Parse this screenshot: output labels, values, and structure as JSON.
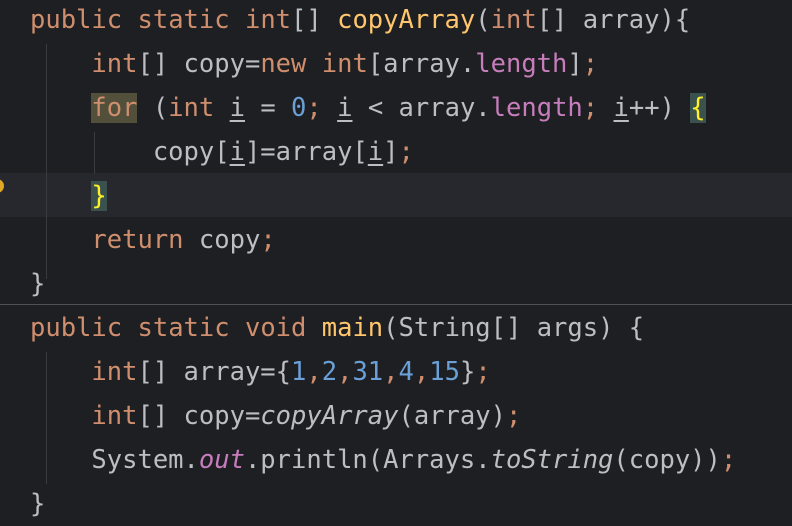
{
  "lines": [
    {
      "segments": [
        [
          "kw",
          "public"
        ],
        [
          " ",
          " "
        ],
        [
          "kw",
          "static"
        ],
        [
          " ",
          " "
        ],
        [
          "kw",
          "int"
        ],
        [
          "plain",
          "[] "
        ],
        [
          "def",
          "copyArray"
        ],
        [
          "plain",
          "("
        ],
        [
          "kw",
          "int"
        ],
        [
          "plain",
          "[] array){"
        ]
      ]
    },
    {
      "segments": [
        [
          "plain",
          "    "
        ],
        [
          "kw",
          "int"
        ],
        [
          "plain",
          "[] copy="
        ],
        [
          "kw",
          "new"
        ],
        [
          "plain",
          " "
        ],
        [
          "kw",
          "int"
        ],
        [
          "plain",
          "[array."
        ],
        [
          "fld",
          "length"
        ],
        [
          "plain",
          "]"
        ],
        [
          "semi",
          ";"
        ]
      ]
    },
    {
      "segments": [
        [
          "plain",
          "    "
        ],
        [
          "kw-hl",
          "for"
        ],
        [
          "plain",
          " ("
        ],
        [
          "kw",
          "int"
        ],
        [
          "plain",
          " "
        ],
        [
          "var-u",
          "i"
        ],
        [
          "plain",
          " = "
        ],
        [
          "num",
          "0"
        ],
        [
          "semi",
          ";"
        ],
        [
          "plain",
          " "
        ],
        [
          "var-u",
          "i"
        ],
        [
          "plain",
          " < array."
        ],
        [
          "fld",
          "length"
        ],
        [
          "semi",
          ";"
        ],
        [
          "plain",
          " "
        ],
        [
          "var-u",
          "i"
        ],
        [
          "plain",
          "++) "
        ],
        [
          "brace-hl",
          "{"
        ]
      ]
    },
    {
      "segments": [
        [
          "plain",
          "        copy["
        ],
        [
          "var-u",
          "i"
        ],
        [
          "plain",
          "]=array["
        ],
        [
          "var-u",
          "i"
        ],
        [
          "plain",
          "]"
        ],
        [
          "semi",
          ";"
        ]
      ]
    },
    {
      "segments": [
        [
          "plain",
          "    "
        ],
        [
          "brace-hl",
          "}"
        ]
      ]
    },
    {
      "segments": [
        [
          "plain",
          "    "
        ],
        [
          "kw",
          "return"
        ],
        [
          "plain",
          " copy"
        ],
        [
          "semi",
          ";"
        ]
      ]
    },
    {
      "segments": [
        [
          "plain",
          "}"
        ]
      ]
    },
    {
      "segments": [
        [
          "kw",
          "public"
        ],
        [
          "plain",
          " "
        ],
        [
          "kw",
          "static"
        ],
        [
          "plain",
          " "
        ],
        [
          "kw",
          "void"
        ],
        [
          "plain",
          " "
        ],
        [
          "def",
          "main"
        ],
        [
          "plain",
          "(String[] args) {"
        ]
      ]
    },
    {
      "segments": [
        [
          "plain",
          "    "
        ],
        [
          "kw",
          "int"
        ],
        [
          "plain",
          "[] array={"
        ],
        [
          "num",
          "1"
        ],
        [
          "semi",
          ","
        ],
        [
          "num",
          "2"
        ],
        [
          "semi",
          ","
        ],
        [
          "num",
          "31"
        ],
        [
          "semi",
          ","
        ],
        [
          "num",
          "4"
        ],
        [
          "semi",
          ","
        ],
        [
          "num",
          "15"
        ],
        [
          "plain",
          "}"
        ],
        [
          "semi",
          ";"
        ]
      ]
    },
    {
      "segments": [
        [
          "plain",
          "    "
        ],
        [
          "kw",
          "int"
        ],
        [
          "plain",
          "[] copy="
        ],
        [
          "it-fn",
          "copyArray"
        ],
        [
          "plain",
          "(array)"
        ],
        [
          "semi",
          ";"
        ]
      ]
    },
    {
      "segments": [
        [
          "plain",
          "    System."
        ],
        [
          "it-fld",
          "out"
        ],
        [
          "plain",
          ".println(Arrays."
        ],
        [
          "it-fn",
          "toString"
        ],
        [
          "plain",
          "(copy))"
        ],
        [
          "semi",
          ";"
        ]
      ]
    },
    {
      "segments": [
        [
          "plain",
          "}"
        ]
      ]
    }
  ]
}
